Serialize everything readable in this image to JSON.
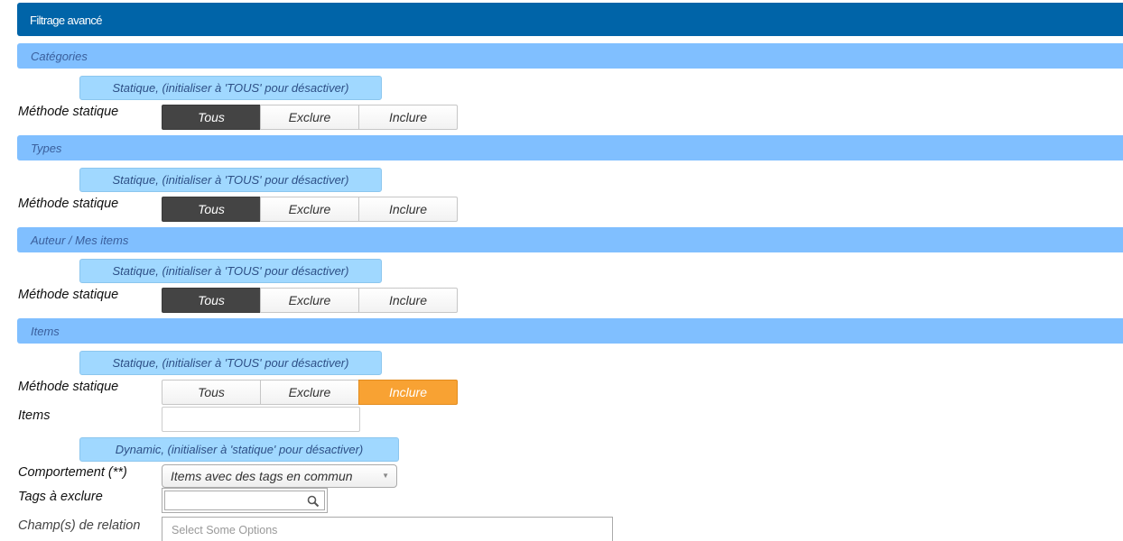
{
  "panel": {
    "title": "Filtrage avancé"
  },
  "sections": [
    {
      "title": "Catégories",
      "mode_label": "Statique, (initialiser à 'TOUS' pour désactiver)",
      "method_label": "Méthode statique",
      "options": [
        "Tous",
        "Exclure",
        "Inclure"
      ],
      "selected": "Tous"
    },
    {
      "title": "Types",
      "mode_label": "Statique, (initialiser à 'TOUS' pour désactiver)",
      "method_label": "Méthode statique",
      "options": [
        "Tous",
        "Exclure",
        "Inclure"
      ],
      "selected": "Tous"
    },
    {
      "title": "Auteur / Mes items",
      "mode_label": "Statique, (initialiser à 'TOUS' pour désactiver)",
      "method_label": "Méthode statique",
      "options": [
        "Tous",
        "Exclure",
        "Inclure"
      ],
      "selected": "Tous"
    },
    {
      "title": "Items",
      "mode_label": "Statique, (initialiser à 'TOUS' pour désactiver)",
      "method_label": "Méthode statique",
      "options": [
        "Tous",
        "Exclure",
        "Inclure"
      ],
      "selected": "Inclure"
    }
  ],
  "items_field": {
    "label": "Items",
    "value": ""
  },
  "dynamic": {
    "mode_label": "Dynamic, (initialiser à 'statique' pour désactiver)",
    "behavior_label": "Comportement (**)",
    "behavior_value": "Items avec des tags en commun",
    "exclude_tags_label": "Tags à exclure",
    "exclude_tags_value": "",
    "relation_label": "Champ(s) de relation",
    "relation_placeholder": "Select Some Options"
  },
  "colors": {
    "header": "#0064a8",
    "section_bar": "#80bfff",
    "mode_tag": "#a0d8ff",
    "active_dark": "#444444",
    "active_orange": "#f8a233"
  },
  "icons": {
    "search": "search-icon",
    "caret": "chevron-down-icon"
  }
}
